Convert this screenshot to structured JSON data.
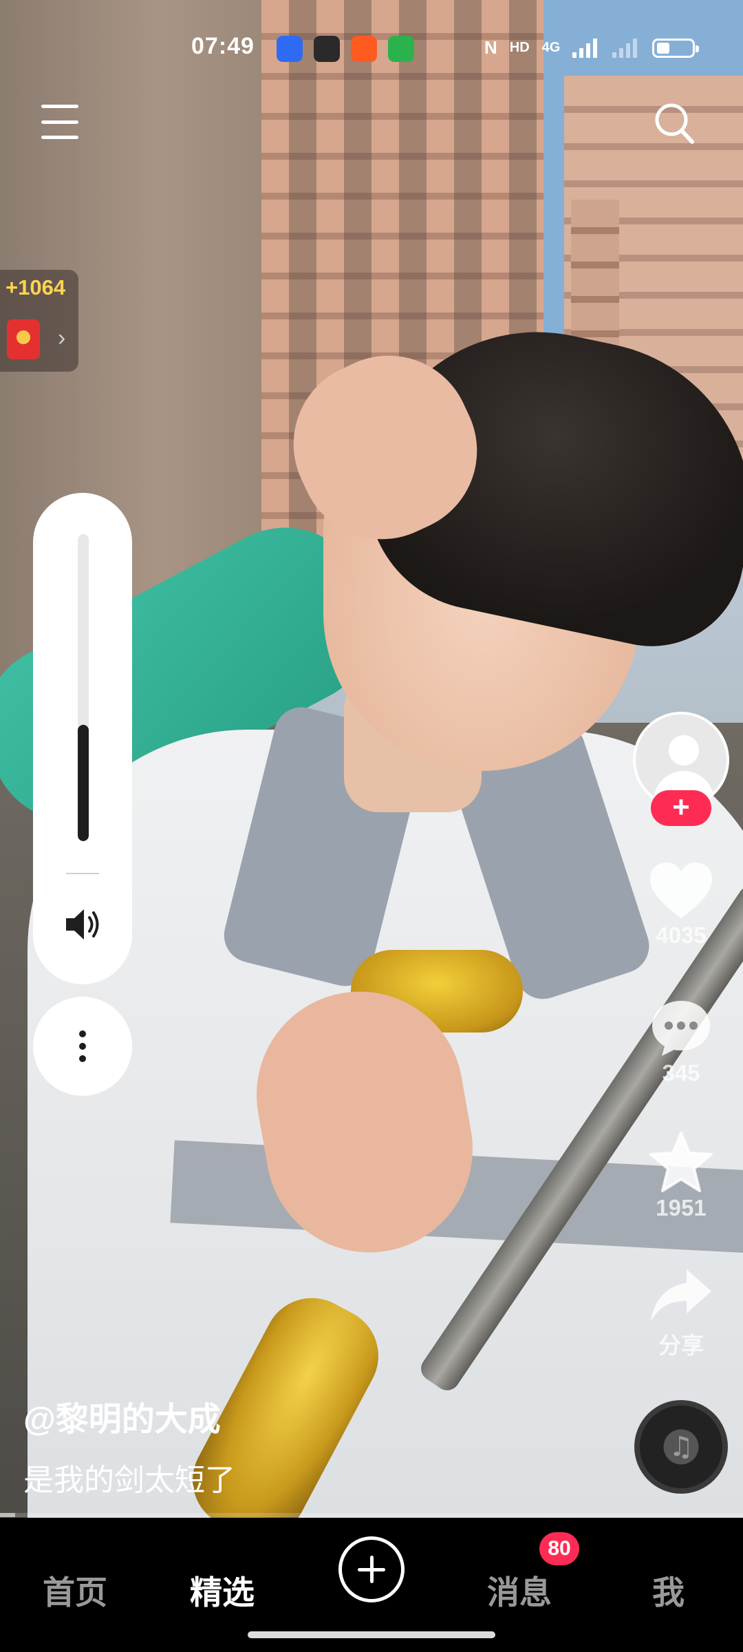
{
  "status_bar": {
    "time": "07:49",
    "network_label": "HD",
    "signal_label": "4G",
    "battery_level": 0.3
  },
  "top_bar": {
    "menu_icon": "hamburger-menu-icon",
    "search_icon": "search-icon"
  },
  "coin_badge": {
    "amount": "+1064",
    "icon": "red-envelope-icon",
    "chevron": "›"
  },
  "volume_panel": {
    "level": 0.38,
    "icon": "speaker-icon",
    "more_icon": "more-vertical-icon"
  },
  "actions": {
    "follow_label": "+",
    "like": {
      "icon": "heart-icon",
      "count": "4035"
    },
    "comment": {
      "icon": "comment-bubble-icon",
      "count": "345"
    },
    "favorite": {
      "icon": "star-icon",
      "count": "1951"
    },
    "share": {
      "icon": "share-arrow-icon",
      "label": "分享"
    },
    "music_icon": "music-disc-icon"
  },
  "caption": {
    "author": "@黎明的大成",
    "description": "是我的剑太短了"
  },
  "playback": {
    "progress": 0.02
  },
  "bottom_nav": {
    "items": [
      {
        "label": "首页",
        "active": false
      },
      {
        "label": "精选",
        "active": true
      },
      {
        "label": "消息",
        "active": false,
        "badge": "80"
      },
      {
        "label": "我",
        "active": false
      }
    ],
    "create_icon": "plus-circle-icon"
  },
  "colors": {
    "accent": "#fe2c55",
    "coin": "#ffd451"
  }
}
